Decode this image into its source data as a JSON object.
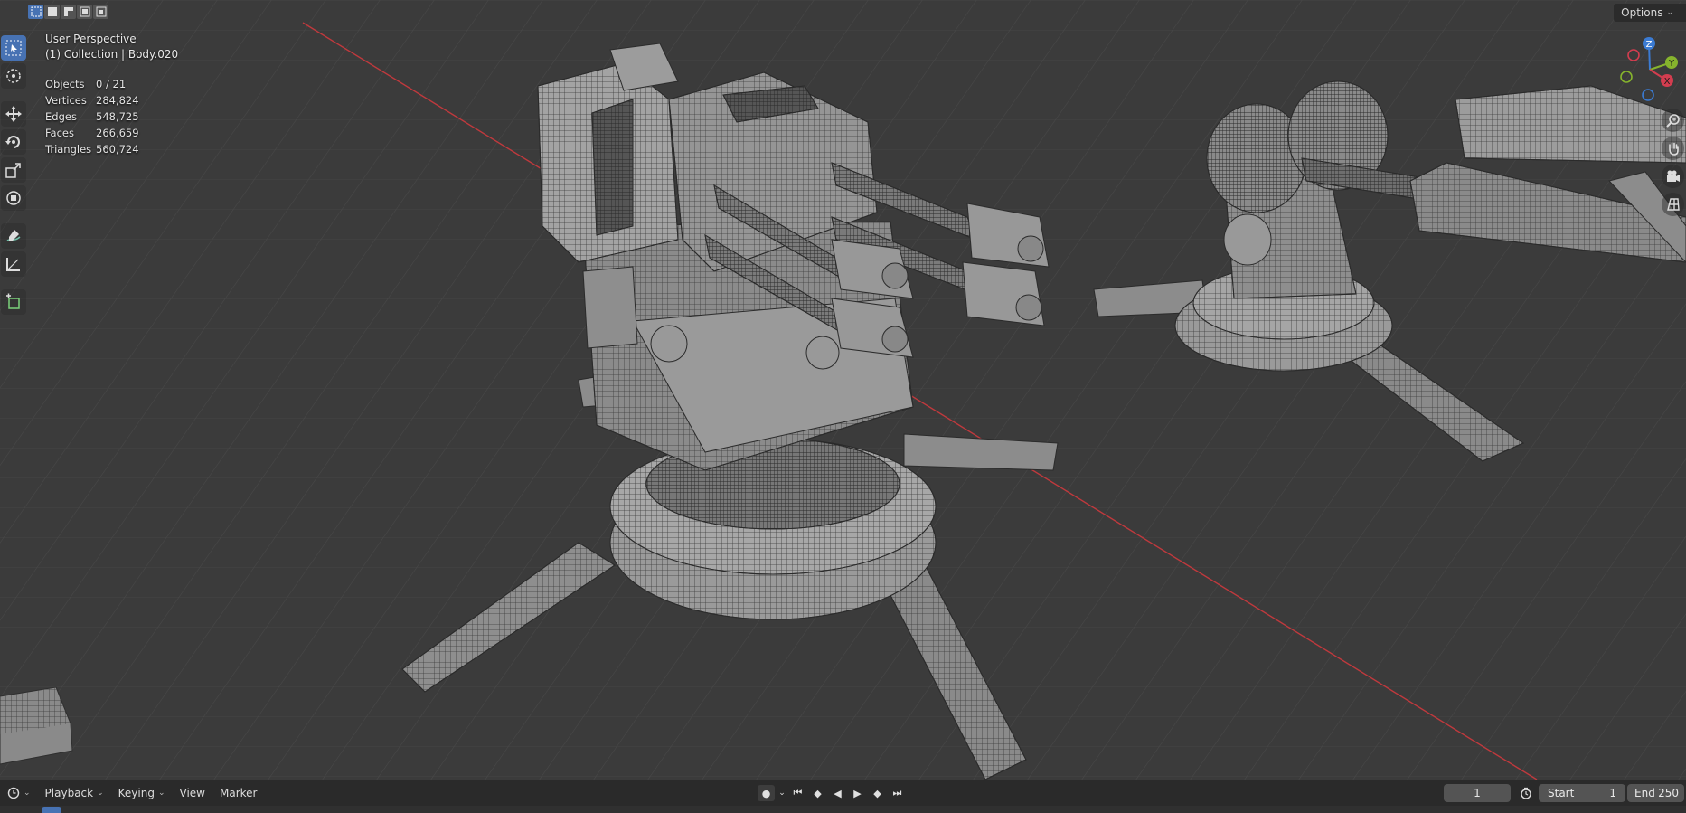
{
  "viewport": {
    "view_name": "User Perspective",
    "collection_label": "(1) Collection | Body.020",
    "options_label": "Options",
    "stats": [
      {
        "label": "Objects",
        "value": "0 / 21"
      },
      {
        "label": "Vertices",
        "value": "284,824"
      },
      {
        "label": "Edges",
        "value": "548,725"
      },
      {
        "label": "Faces",
        "value": "266,659"
      },
      {
        "label": "Triangles",
        "value": "560,724"
      }
    ],
    "gizmo": {
      "z": "Z",
      "y": "Y",
      "x": "X"
    },
    "colors": {
      "x_axis": "#d33d4f",
      "y_axis": "#86b42d",
      "z_axis": "#3b7bd3",
      "active": "#4772b3",
      "grid_bg": "#3a3a3a"
    }
  },
  "toolbar": {
    "tools": [
      "select-box",
      "cursor",
      "move",
      "rotate",
      "scale",
      "transform",
      "annotate",
      "measure",
      "add-cube"
    ]
  },
  "timeline": {
    "menus": [
      "Playback",
      "Keying",
      "View",
      "Marker"
    ],
    "current_frame": "1",
    "start_label": "Start",
    "start_value": "1",
    "end_label": "End",
    "end_value": "250"
  }
}
